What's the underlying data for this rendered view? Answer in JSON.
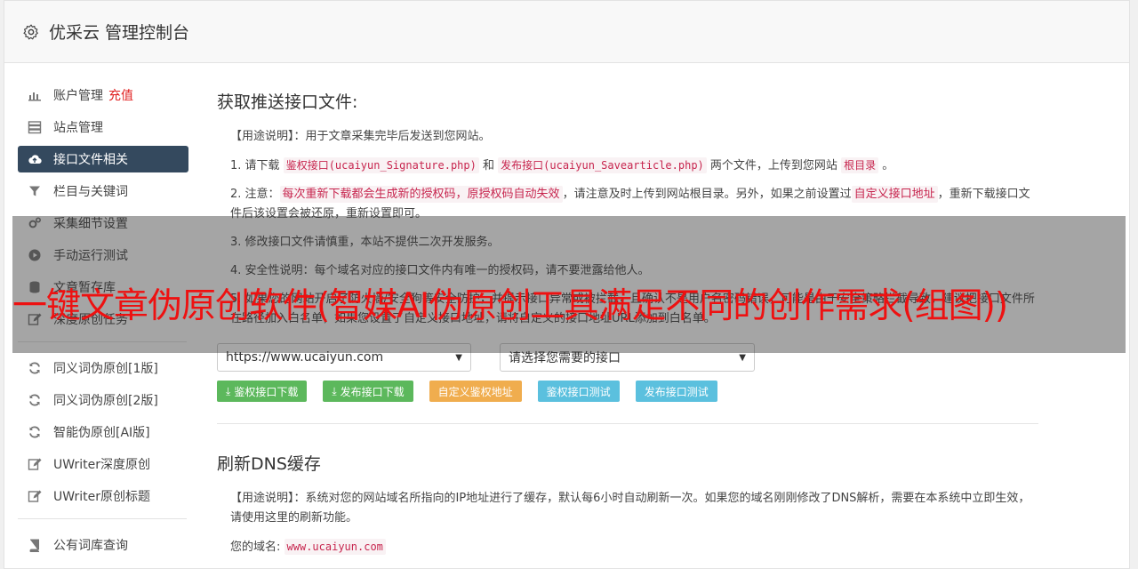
{
  "app": {
    "title": "优采云 管理控制台"
  },
  "sidebar": {
    "items": [
      {
        "label": "账户管理",
        "extra": "充值",
        "icon": "bar-chart-icon"
      },
      {
        "label": "站点管理",
        "icon": "server-icon"
      },
      {
        "label": "接口文件相关",
        "icon": "cloud-upload-icon",
        "active": true
      },
      {
        "label": "栏目与关键词",
        "icon": "filter-icon"
      },
      {
        "label": "采集细节设置",
        "icon": "cogs-icon"
      },
      {
        "label": "手动运行测试",
        "icon": "play-circle-icon"
      },
      {
        "label": "文章暂存库",
        "icon": "database-icon"
      },
      {
        "label": "深度原创任务",
        "icon": "edit-icon"
      }
    ],
    "items2": [
      {
        "label": "同义词伪原创[1版]",
        "icon": "refresh-icon"
      },
      {
        "label": "同义词伪原创[2版]",
        "icon": "refresh-icon"
      },
      {
        "label": "智能伪原创[AI版]",
        "icon": "refresh-icon"
      },
      {
        "label": "UWriter深度原创",
        "icon": "edit-icon"
      },
      {
        "label": "UWriter原创标题",
        "icon": "edit-icon"
      }
    ],
    "items3": [
      {
        "label": "公有词库查询",
        "icon": "book-icon"
      }
    ]
  },
  "section1": {
    "title": "获取推送接口文件:",
    "usage": "【用途说明】：用于文章采集完毕后发送到您网站。",
    "step1": {
      "pre": "1. 请下载",
      "code1": "鉴权接口(ucaiyun_Signature.php)",
      "mid": "和",
      "code2": "发布接口(ucaiyun_Savearticle.php)",
      "post": "两个文件，上传到您网站",
      "code3": "根目录",
      "end": "。"
    },
    "step2": {
      "pre": "2. 注意：",
      "code1": "每次重新下载都会生成新的授权码，原授权码自动失效",
      "mid": "，请注意及时上传到网站根目录。另外，如果之前设置过",
      "code2": "自定义接口地址",
      "post": "，重新下载接口文件后该设置会被还原，重新设置即可。"
    },
    "step3": "3. 修改接口文件请慎重，本站不提供二次开发服务。",
    "step4": "4. 安全性说明：每个域名对应的接口文件内有唯一的授权码，请不要泄露给他人。",
    "step5": "5. 如果您的网站开启了防火墙/安全狗等安全防护，并提示接口异常或被拦截，且确认不是用户名密码错误，可能是由于安全策略拦截导致，建议把接口文件所在路径加入白名单，如果您设置了自定义接口地址，请将自定义的接口地址URL添加到白名单。",
    "site_select": "https://www.ucaiyun.com",
    "iface_select": "请选择您需要的接口",
    "buttons": {
      "sig_download": "鉴权接口下载",
      "pub_download": "发布接口下载",
      "custom_addr": "自定义鉴权地址",
      "sig_test": "鉴权接口测试",
      "pub_test": "发布接口测试"
    }
  },
  "section2": {
    "title": "刷新DNS缓存",
    "usage": "【用途说明】：系统对您的网站域名所指向的IP地址进行了缓存，默认每6小时自动刷新一次。如果您的域名刚刚修改了DNS解析，需要在本系统中立即生效，请使用这里的刷新功能。",
    "domain_label": "您的域名:",
    "domain_value": "www.ucaiyun.com"
  },
  "overlay": {
    "headline": "一键文章伪原创软件(智媒AI伪原创工具满足不同的创作需求(组图))"
  },
  "colors": {
    "active_nav": "#34495e",
    "headline": "#ee1111",
    "btn_green": "#5cb85c",
    "btn_orange": "#f0ad4e",
    "btn_blue": "#5bc0de",
    "code": "#c7254e"
  }
}
